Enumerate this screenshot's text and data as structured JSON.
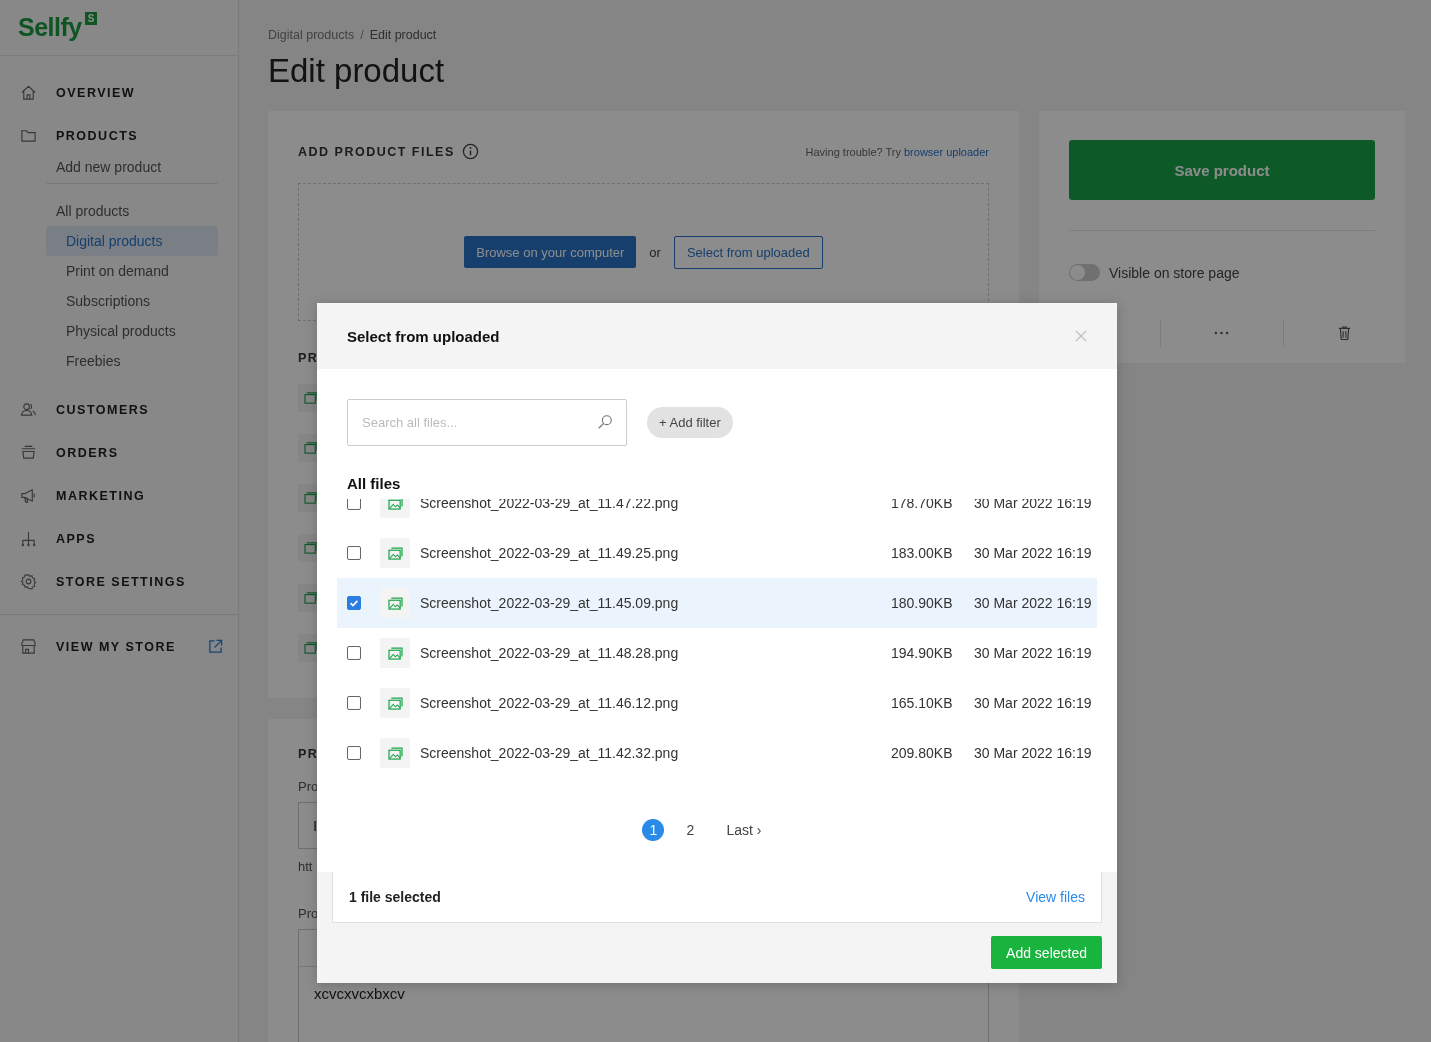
{
  "brand": {
    "name": "Sellfy",
    "badge": "S"
  },
  "sidebar": {
    "items": [
      {
        "label": "OVERVIEW"
      },
      {
        "label": "PRODUCTS",
        "children": {
          "add_label": "Add new product",
          "all_label": "All products",
          "categories": [
            {
              "label": "Digital products",
              "selected": true
            },
            {
              "label": "Print on demand",
              "selected": false
            },
            {
              "label": "Subscriptions",
              "selected": false
            },
            {
              "label": "Physical products",
              "selected": false
            },
            {
              "label": "Freebies",
              "selected": false
            }
          ]
        }
      },
      {
        "label": "CUSTOMERS"
      },
      {
        "label": "ORDERS"
      },
      {
        "label": "MARKETING"
      },
      {
        "label": "APPS"
      },
      {
        "label": "STORE SETTINGS"
      }
    ],
    "view_store": "VIEW MY STORE"
  },
  "breadcrumb": [
    "Digital products",
    "Edit product"
  ],
  "breadcrumb_separator": "/",
  "page_title": "Edit product",
  "files_card": {
    "title": "ADD PRODUCT FILES",
    "help_text": "Having trouble? Try",
    "help_link": "browser uploader",
    "browse_button": "Browse on your computer",
    "or": "or",
    "select_button": "Select from uploaded",
    "section_cut": "PR"
  },
  "details_card": {
    "heading_cut": "PR",
    "label_1_cut": "Pro",
    "value_cut": "I",
    "url_cut": "htt",
    "label_2_cut": "Pro",
    "description": "xcvcxvcxbxcv"
  },
  "side_panel": {
    "save_button": "Save product",
    "visible": {
      "label": "Visible on store page",
      "on": false
    }
  },
  "modal": {
    "title": "Select from uploaded",
    "search": {
      "placeholder": "Search all files..."
    },
    "filter_button": "+ Add filter",
    "list_title": "All files",
    "files": [
      {
        "name": "Screenshot_2022-03-29_at_11.47.22.png",
        "size": "178.70KB",
        "date": "30 Mar 2022 16:19",
        "checked": false
      },
      {
        "name": "Screenshot_2022-03-29_at_11.49.25.png",
        "size": "183.00KB",
        "date": "30 Mar 2022 16:19",
        "checked": false
      },
      {
        "name": "Screenshot_2022-03-29_at_11.45.09.png",
        "size": "180.90KB",
        "date": "30 Mar 2022 16:19",
        "checked": true
      },
      {
        "name": "Screenshot_2022-03-29_at_11.48.28.png",
        "size": "194.90KB",
        "date": "30 Mar 2022 16:19",
        "checked": false
      },
      {
        "name": "Screenshot_2022-03-29_at_11.46.12.png",
        "size": "165.10KB",
        "date": "30 Mar 2022 16:19",
        "checked": false
      },
      {
        "name": "Screenshot_2022-03-29_at_11.42.32.png",
        "size": "209.80KB",
        "date": "30 Mar 2022 16:19",
        "checked": false
      }
    ],
    "pagination": [
      {
        "label": "1",
        "selected": true
      },
      {
        "label": "2",
        "selected": false
      }
    ],
    "last_link": "Last ›",
    "selection_summary": "1 file selected",
    "view_files": "View files",
    "add_button": "Add selected"
  }
}
